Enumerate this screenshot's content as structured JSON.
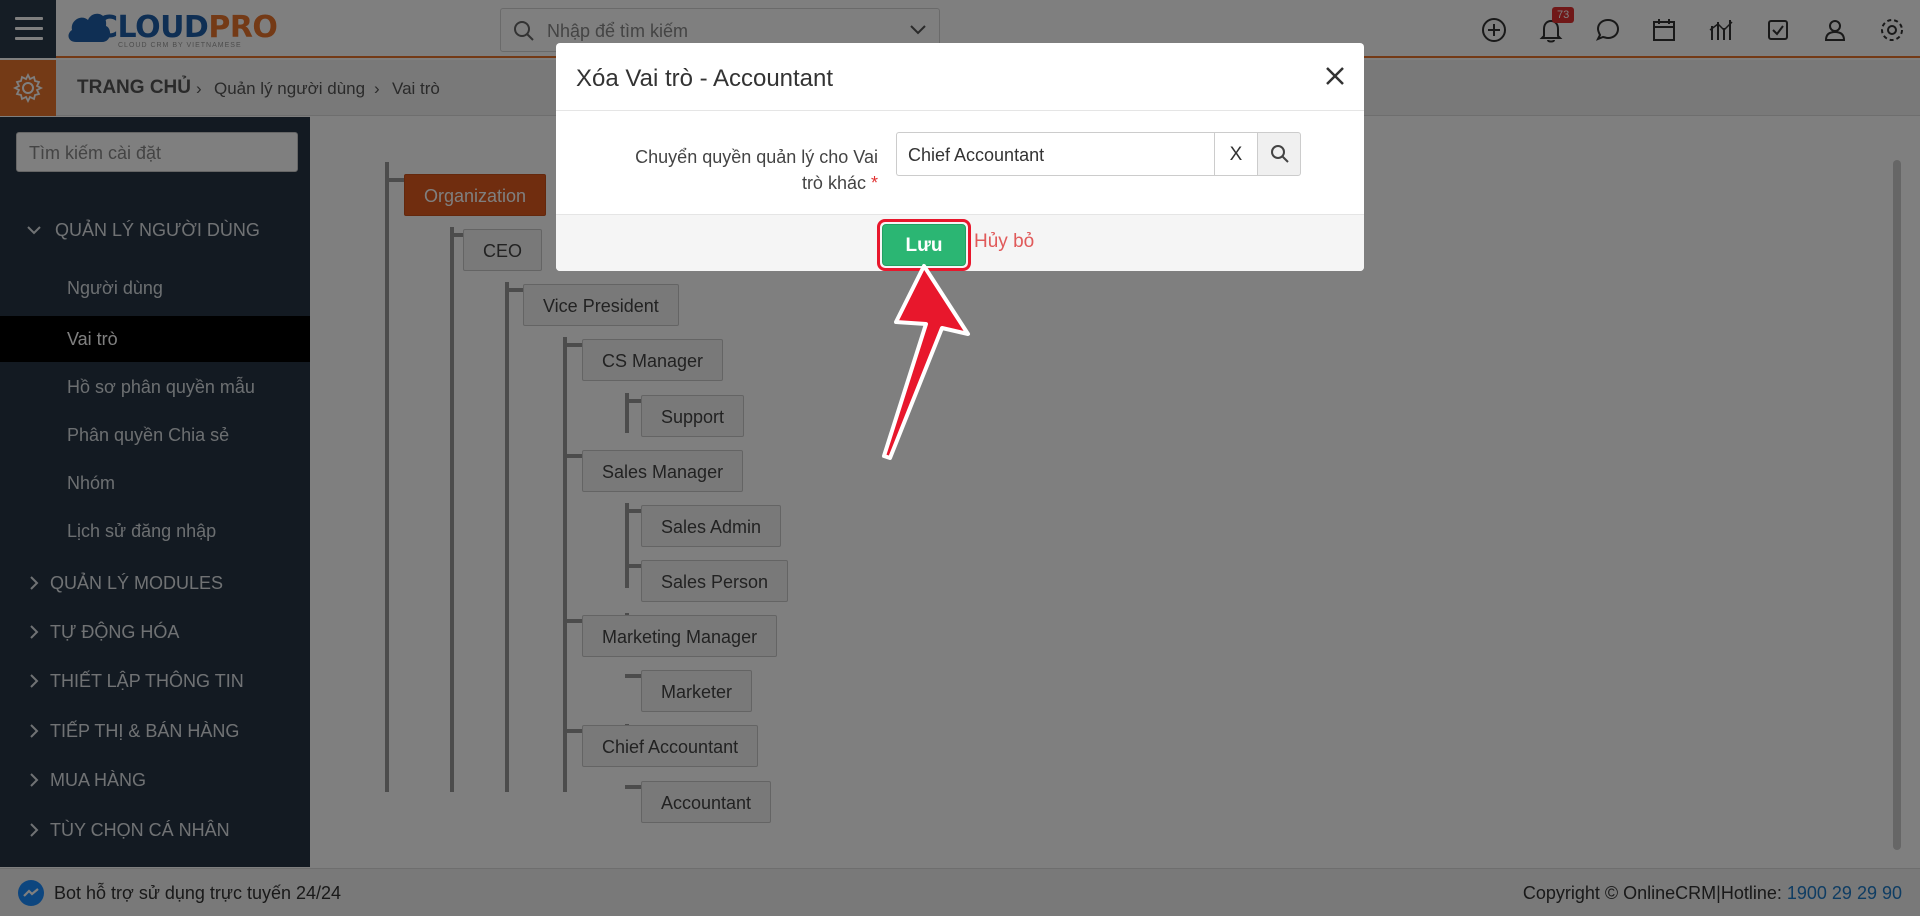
{
  "header": {
    "logo_text_a": "CLOUD",
    "logo_text_b": "PRO",
    "logo_tagline": "CLOUD CRM BY VIETNAMESE",
    "search_placeholder": "Nhập để tìm kiếm",
    "notification_count": "73",
    "icons": [
      "plus-circle-icon",
      "bell-icon",
      "chat-icon",
      "calendar-icon",
      "report-icon",
      "task-icon",
      "user-icon",
      "gear-icon"
    ]
  },
  "breadcrumb": {
    "home": "TRANG CHỦ",
    "items": [
      "Quản lý người dùng",
      "Vai trò"
    ]
  },
  "sidebar": {
    "search_placeholder": "Tìm kiếm cài đặt",
    "sections": [
      {
        "title": "QUẢN LÝ NGƯỜI DÙNG",
        "expanded": true,
        "items": [
          {
            "label": "Người dùng",
            "active": false
          },
          {
            "label": "Vai trò",
            "active": true
          },
          {
            "label": "Hồ sơ phân quyền mẫu",
            "active": false
          },
          {
            "label": "Phân quyền Chia sẻ",
            "active": false
          },
          {
            "label": "Nhóm",
            "active": false
          },
          {
            "label": "Lịch sử đăng nhập",
            "active": false
          }
        ]
      },
      {
        "title": "QUẢN LÝ MODULES",
        "expanded": false
      },
      {
        "title": "TỰ ĐỘNG HÓA",
        "expanded": false
      },
      {
        "title": "THIẾT LẬP THÔNG TIN",
        "expanded": false
      },
      {
        "title": "TIẾP THỊ & BÁN HÀNG",
        "expanded": false
      },
      {
        "title": "MUA HÀNG",
        "expanded": false
      },
      {
        "title": "TÙY CHỌN CÁ NHÂN",
        "expanded": false
      }
    ]
  },
  "role_tree": {
    "nodes": [
      {
        "label": "Organization",
        "depth": 0
      },
      {
        "label": "CEO",
        "depth": 1
      },
      {
        "label": "Vice President",
        "depth": 2
      },
      {
        "label": "CS Manager",
        "depth": 3
      },
      {
        "label": "Support",
        "depth": 4
      },
      {
        "label": "Sales Manager",
        "depth": 3
      },
      {
        "label": "Sales Admin",
        "depth": 4
      },
      {
        "label": "Sales Person",
        "depth": 4
      },
      {
        "label": "Marketing Manager",
        "depth": 3
      },
      {
        "label": "Marketer",
        "depth": 4
      },
      {
        "label": "Chief Accountant",
        "depth": 3
      },
      {
        "label": "Accountant",
        "depth": 4
      }
    ]
  },
  "modal": {
    "title": "Xóa Vai trò - Accountant",
    "field_label_line1": "Chuyển quyền quản lý cho Vai",
    "field_label_line2": "trò khác",
    "required_mark": "*",
    "field_value": "Chief Accountant",
    "clear_label": "X",
    "save_label": "Lưu",
    "cancel_label": "Hủy bỏ"
  },
  "footer": {
    "bot_text": "Bot hỗ trợ sử dụng trực tuyến 24/24",
    "copyright": "Copyright © OnlineCRM|Hotline: ",
    "hotline": "1900 29 29 90"
  },
  "colors": {
    "accent_orange": "#e8742c",
    "sidebar_bg": "#263544",
    "save_green": "#2bb673",
    "highlight_red": "#e8172c"
  }
}
